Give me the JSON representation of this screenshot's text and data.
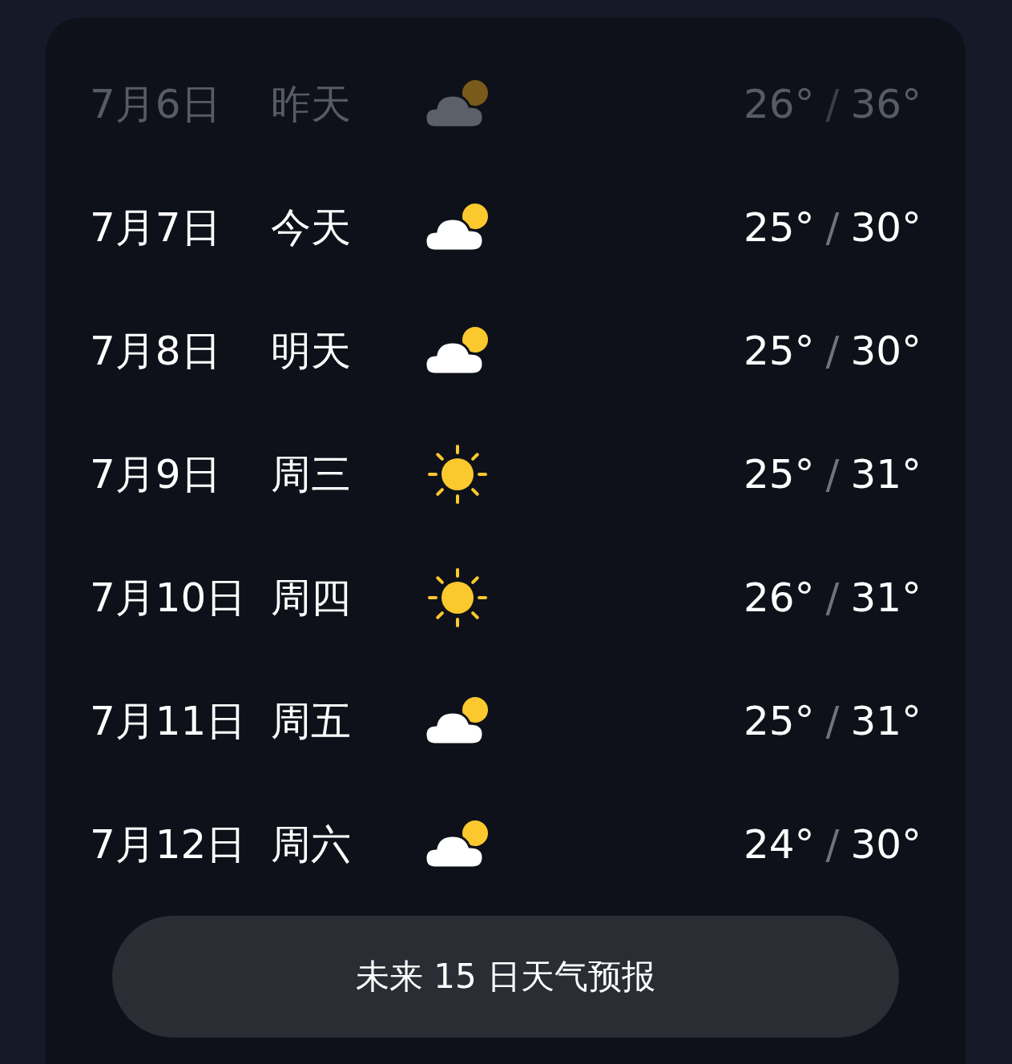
{
  "days": [
    {
      "date": "7月6日",
      "day": "昨天",
      "kind": "cloudy",
      "low": "26°",
      "sep": "/",
      "high": "36°",
      "past": true
    },
    {
      "date": "7月7日",
      "day": "今天",
      "kind": "cloudy",
      "low": "25°",
      "sep": "/",
      "high": "30°",
      "past": false
    },
    {
      "date": "7月8日",
      "day": "明天",
      "kind": "cloudy",
      "low": "25°",
      "sep": "/",
      "high": "30°",
      "past": false
    },
    {
      "date": "7月9日",
      "day": "周三",
      "kind": "sunny",
      "low": "25°",
      "sep": "/",
      "high": "31°",
      "past": false
    },
    {
      "date": "7月10日",
      "day": "周四",
      "kind": "sunny",
      "low": "26°",
      "sep": "/",
      "high": "31°",
      "past": false
    },
    {
      "date": "7月11日",
      "day": "周五",
      "kind": "cloudy",
      "low": "25°",
      "sep": "/",
      "high": "31°",
      "past": false
    },
    {
      "date": "7月12日",
      "day": "周六",
      "kind": "cloudy",
      "low": "24°",
      "sep": "/",
      "high": "30°",
      "past": false
    }
  ],
  "forecast_button": "未来 15 日天气预报"
}
